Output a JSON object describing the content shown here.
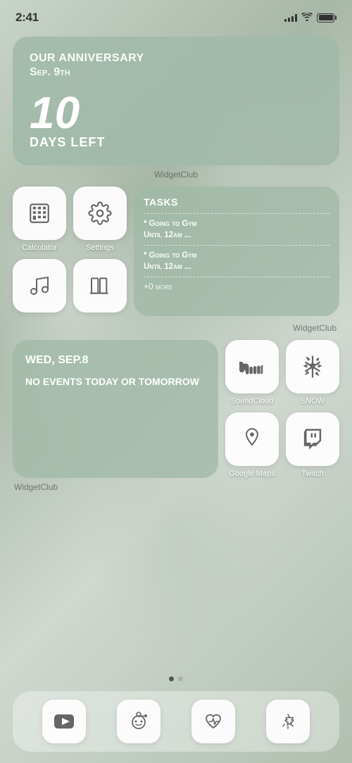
{
  "statusBar": {
    "time": "2:41",
    "signal": "4 bars",
    "wifi": "on",
    "battery": "full"
  },
  "anniversaryWidget": {
    "title": "Our Anniversary",
    "date": "Sep. 9th",
    "daysNumber": "10",
    "daysLabel": "Days Left",
    "widgetClubLabel": "WidgetClub"
  },
  "appsRow": {
    "widgetClubLabel": "WidgetClub",
    "apps": [
      {
        "id": "calculator",
        "label": "Calculator",
        "symbol": "calculator"
      },
      {
        "id": "settings",
        "label": "Settings",
        "symbol": "gear"
      },
      {
        "id": "music",
        "label": "",
        "symbol": "music"
      },
      {
        "id": "library",
        "label": "",
        "symbol": "library"
      }
    ],
    "tasksWidget": {
      "title": "Tasks",
      "items": [
        "* Going to Gym\nUntil 12am ...",
        "* Going to Gym\nUntil 12am ..."
      ],
      "more": "+0 more"
    }
  },
  "calendarRow": {
    "calendarWidget": {
      "day": "Wed, Sep.8",
      "noEvents": "No events today\nor tomorrow"
    },
    "widgetClubLabel": "WidgetClub",
    "apps": [
      {
        "id": "soundcloud",
        "label": "SoundCloud",
        "symbol": "soundcloud"
      },
      {
        "id": "snow",
        "label": "SNOW",
        "symbol": "snow"
      },
      {
        "id": "googlemaps",
        "label": "Google Maps",
        "symbol": "maps"
      },
      {
        "id": "twitch",
        "label": "Twitch",
        "symbol": "twitch"
      }
    ]
  },
  "pageIndicator": {
    "activeDot": 0,
    "totalDots": 2
  },
  "dock": {
    "apps": [
      {
        "id": "youtube",
        "label": "YouTube",
        "symbol": "youtube"
      },
      {
        "id": "reddit",
        "label": "Reddit",
        "symbol": "reddit"
      },
      {
        "id": "health",
        "label": "Health",
        "symbol": "health"
      },
      {
        "id": "appstore",
        "label": "App Store",
        "symbol": "appstore"
      }
    ]
  }
}
